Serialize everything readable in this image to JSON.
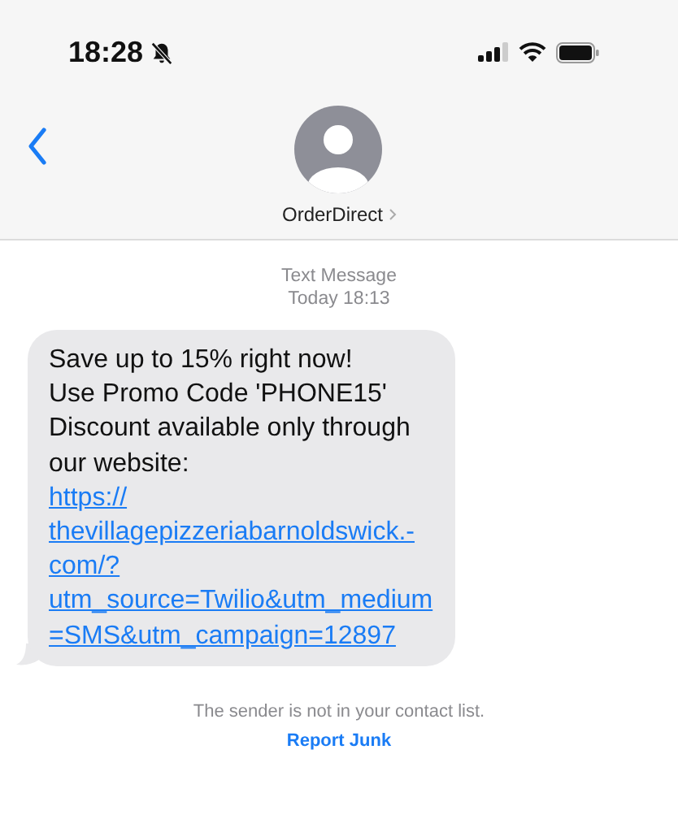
{
  "status_bar": {
    "time": "18:28",
    "silent": true
  },
  "header": {
    "contact_name": "OrderDirect"
  },
  "thread": {
    "service": "Text Message",
    "timestamp": "Today 18:13"
  },
  "message": {
    "text_lines": [
      "Save up to 15% right now!",
      "Use Promo Code 'PHONE15'",
      "Discount available only through",
      "our website:"
    ],
    "link_lines": [
      "https://",
      "thevillagepizzeriabarnoldswick.-",
      "com/?",
      "utm_source=Twilio&utm_medium",
      "=SMS&utm_campaign=12897"
    ]
  },
  "notice": {
    "text": "The sender is not in your contact list.",
    "action": "Report Junk"
  }
}
